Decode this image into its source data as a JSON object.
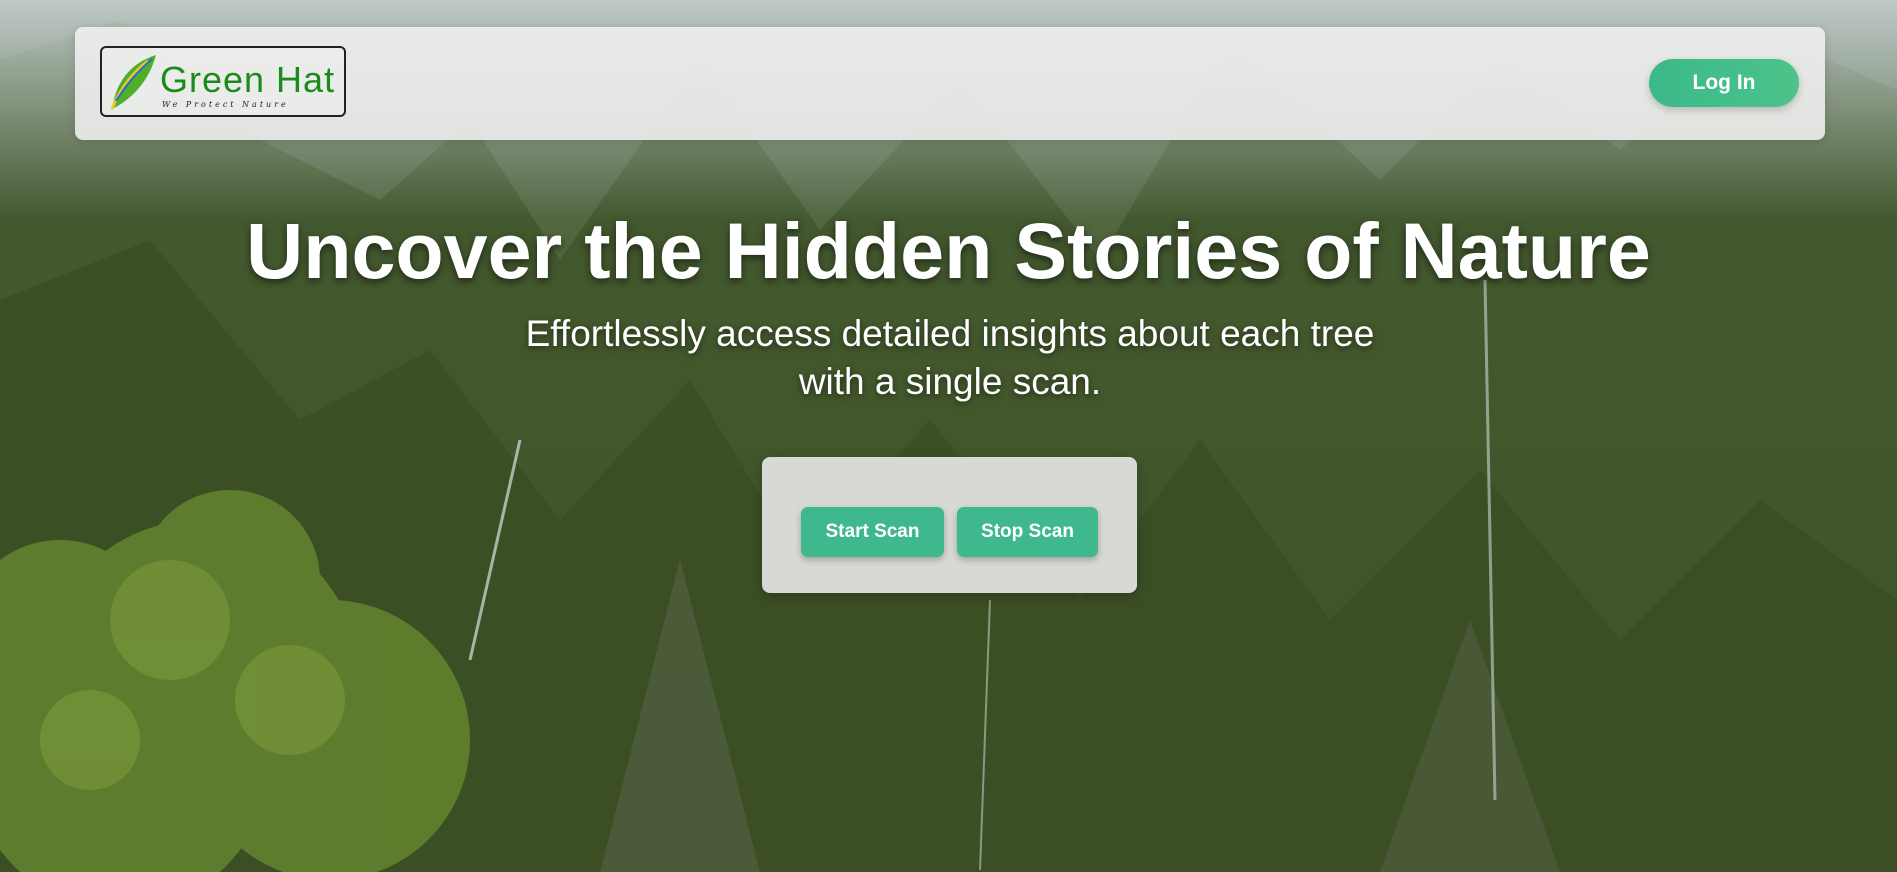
{
  "header": {
    "logo": {
      "name": "Green Hat",
      "tagline": "We Protect Nature"
    },
    "login_label": "Log In"
  },
  "hero": {
    "title": "Uncover the Hidden Stories of Nature",
    "subtitle": "Effortlessly access detailed insights about each tree with a single scan."
  },
  "scan_controls": {
    "start_label": "Start Scan",
    "stop_label": "Stop Scan"
  },
  "colors": {
    "accent": "#3eb88c",
    "logo_text": "#1e8a1e"
  }
}
